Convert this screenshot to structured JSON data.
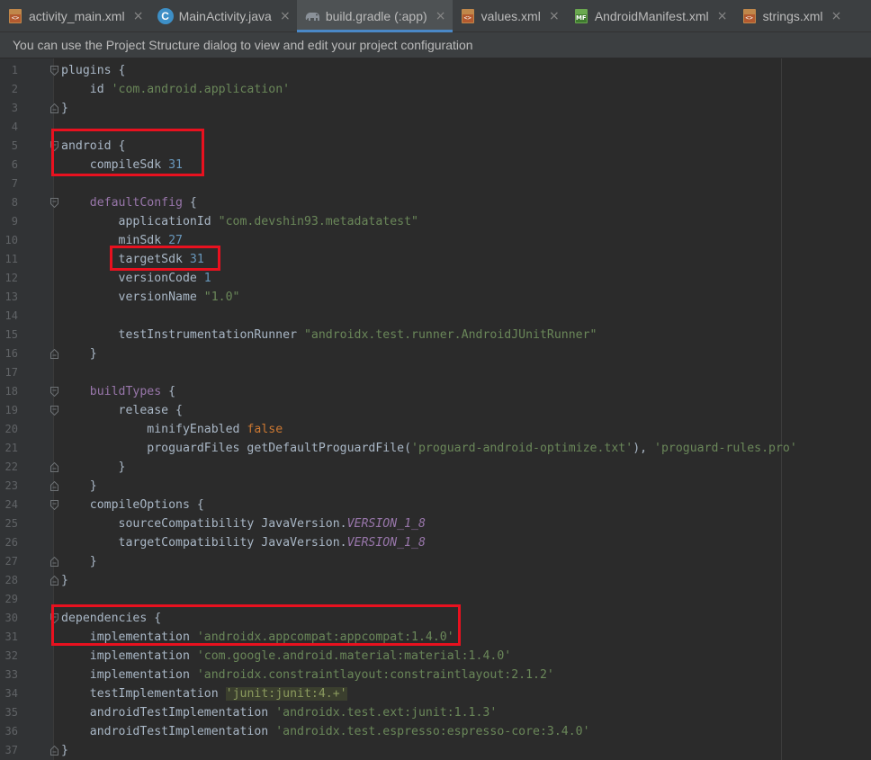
{
  "tabs": [
    {
      "id": "activity-main",
      "label": "activity_main.xml",
      "icon": "xml-file-icon",
      "active": false
    },
    {
      "id": "main-activity",
      "label": "MainActivity.java",
      "icon": "java-class-icon",
      "active": false
    },
    {
      "id": "build-gradle",
      "label": "build.gradle (:app)",
      "icon": "gradle-elephant-icon",
      "active": true
    },
    {
      "id": "values",
      "label": "values.xml",
      "icon": "xml-file-icon",
      "active": false
    },
    {
      "id": "android-manifest",
      "label": "AndroidManifest.xml",
      "icon": "manifest-file-icon",
      "active": false
    },
    {
      "id": "strings",
      "label": "strings.xml",
      "icon": "xml-file-icon",
      "active": false
    }
  ],
  "close_glyph": "×",
  "notice": {
    "text": "You can use the Project Structure dialog to view and edit your project configuration"
  },
  "editor": {
    "lines": [
      {
        "n": "1",
        "fold": "open",
        "tokens": [
          [
            "t-plain",
            "plugins {"
          ]
        ]
      },
      {
        "n": "2",
        "tokens": [
          [
            "t-plain",
            "    id "
          ],
          [
            "t-str",
            "'com.android.application'"
          ]
        ]
      },
      {
        "n": "3",
        "fold": "close",
        "tokens": [
          [
            "t-plain",
            "}"
          ]
        ]
      },
      {
        "n": "4",
        "tokens": []
      },
      {
        "n": "5",
        "fold": "open",
        "tokens": [
          [
            "t-plain",
            "android {"
          ]
        ]
      },
      {
        "n": "6",
        "tokens": [
          [
            "t-plain",
            "    compileSdk "
          ],
          [
            "t-num",
            "31"
          ]
        ]
      },
      {
        "n": "7",
        "tokens": []
      },
      {
        "n": "8",
        "fold": "open",
        "tokens": [
          [
            "t-plain",
            "    "
          ],
          [
            "t-fn",
            "defaultConfig"
          ],
          [
            "t-plain",
            " {"
          ]
        ]
      },
      {
        "n": "9",
        "tokens": [
          [
            "t-plain",
            "        applicationId "
          ],
          [
            "t-str",
            "\"com.devshin93.metadatatest\""
          ]
        ]
      },
      {
        "n": "10",
        "tokens": [
          [
            "t-plain",
            "        minSdk "
          ],
          [
            "t-num",
            "27"
          ]
        ]
      },
      {
        "n": "11",
        "tokens": [
          [
            "t-plain",
            "        targetSdk "
          ],
          [
            "t-num",
            "31"
          ]
        ]
      },
      {
        "n": "12",
        "tokens": [
          [
            "t-plain",
            "        versionCode "
          ],
          [
            "t-num",
            "1"
          ]
        ]
      },
      {
        "n": "13",
        "tokens": [
          [
            "t-plain",
            "        versionName "
          ],
          [
            "t-str",
            "\"1.0\""
          ]
        ]
      },
      {
        "n": "14",
        "tokens": []
      },
      {
        "n": "15",
        "tokens": [
          [
            "t-plain",
            "        testInstrumentationRunner "
          ],
          [
            "t-str",
            "\"androidx.test.runner.AndroidJUnitRunner\""
          ]
        ]
      },
      {
        "n": "16",
        "fold": "close",
        "tokens": [
          [
            "t-plain",
            "    }"
          ]
        ]
      },
      {
        "n": "17",
        "tokens": []
      },
      {
        "n": "18",
        "fold": "open",
        "tokens": [
          [
            "t-plain",
            "    "
          ],
          [
            "t-fn",
            "buildTypes"
          ],
          [
            "t-plain",
            " {"
          ]
        ]
      },
      {
        "n": "19",
        "fold": "open",
        "tokens": [
          [
            "t-plain",
            "        release {"
          ]
        ]
      },
      {
        "n": "20",
        "tokens": [
          [
            "t-plain",
            "            minifyEnabled "
          ],
          [
            "t-kw",
            "false"
          ]
        ]
      },
      {
        "n": "21",
        "tokens": [
          [
            "t-plain",
            "            proguardFiles getDefaultProguardFile("
          ],
          [
            "t-str",
            "'proguard-android-optimize.txt'"
          ],
          [
            "t-plain",
            "), "
          ],
          [
            "t-str",
            "'proguard-rules.pro'"
          ]
        ]
      },
      {
        "n": "22",
        "fold": "close",
        "tokens": [
          [
            "t-plain",
            "        }"
          ]
        ]
      },
      {
        "n": "23",
        "fold": "close",
        "tokens": [
          [
            "t-plain",
            "    }"
          ]
        ]
      },
      {
        "n": "24",
        "fold": "open",
        "tokens": [
          [
            "t-plain",
            "    compileOptions {"
          ]
        ]
      },
      {
        "n": "25",
        "tokens": [
          [
            "t-plain",
            "        sourceCompatibility JavaVersion."
          ],
          [
            "t-const",
            "VERSION_1_8"
          ]
        ]
      },
      {
        "n": "26",
        "tokens": [
          [
            "t-plain",
            "        targetCompatibility JavaVersion."
          ],
          [
            "t-const",
            "VERSION_1_8"
          ]
        ]
      },
      {
        "n": "27",
        "fold": "close",
        "tokens": [
          [
            "t-plain",
            "    }"
          ]
        ]
      },
      {
        "n": "28",
        "fold": "close",
        "tokens": [
          [
            "t-plain",
            "}"
          ]
        ]
      },
      {
        "n": "29",
        "tokens": []
      },
      {
        "n": "30",
        "fold": "open",
        "tokens": [
          [
            "t-plain",
            "dependencies {"
          ]
        ]
      },
      {
        "n": "31",
        "tokens": [
          [
            "t-plain",
            "    implementation "
          ],
          [
            "t-str",
            "'androidx.appcompat:appcompat:1.4.0'"
          ]
        ]
      },
      {
        "n": "32",
        "tokens": [
          [
            "t-plain",
            "    implementation "
          ],
          [
            "t-str",
            "'com.google.android.material:material:1.4.0'"
          ]
        ]
      },
      {
        "n": "33",
        "tokens": [
          [
            "t-plain",
            "    implementation "
          ],
          [
            "t-str",
            "'androidx.constraintlayout:constraintlayout:2.1.2'"
          ]
        ]
      },
      {
        "n": "34",
        "tokens": [
          [
            "t-plain",
            "    testImplementation "
          ],
          [
            "t-str hl",
            "'junit:junit:4.+'"
          ]
        ]
      },
      {
        "n": "35",
        "tokens": [
          [
            "t-plain",
            "    androidTestImplementation "
          ],
          [
            "t-str",
            "'androidx.test.ext:junit:1.1.3'"
          ]
        ]
      },
      {
        "n": "36",
        "tokens": [
          [
            "t-plain",
            "    androidTestImplementation "
          ],
          [
            "t-str",
            "'androidx.test.espresso:espresso-core:3.4.0'"
          ]
        ]
      },
      {
        "n": "37",
        "fold": "close",
        "tokens": [
          [
            "t-plain",
            "}"
          ]
        ]
      }
    ]
  },
  "colors": {
    "background": "#2b2b2b",
    "string": "#6a8759",
    "number": "#6897bb",
    "keyword": "#cc7832",
    "method": "#9876aa",
    "highlight_box": "#e8111f",
    "active_tab_underline": "#4a88c7"
  }
}
